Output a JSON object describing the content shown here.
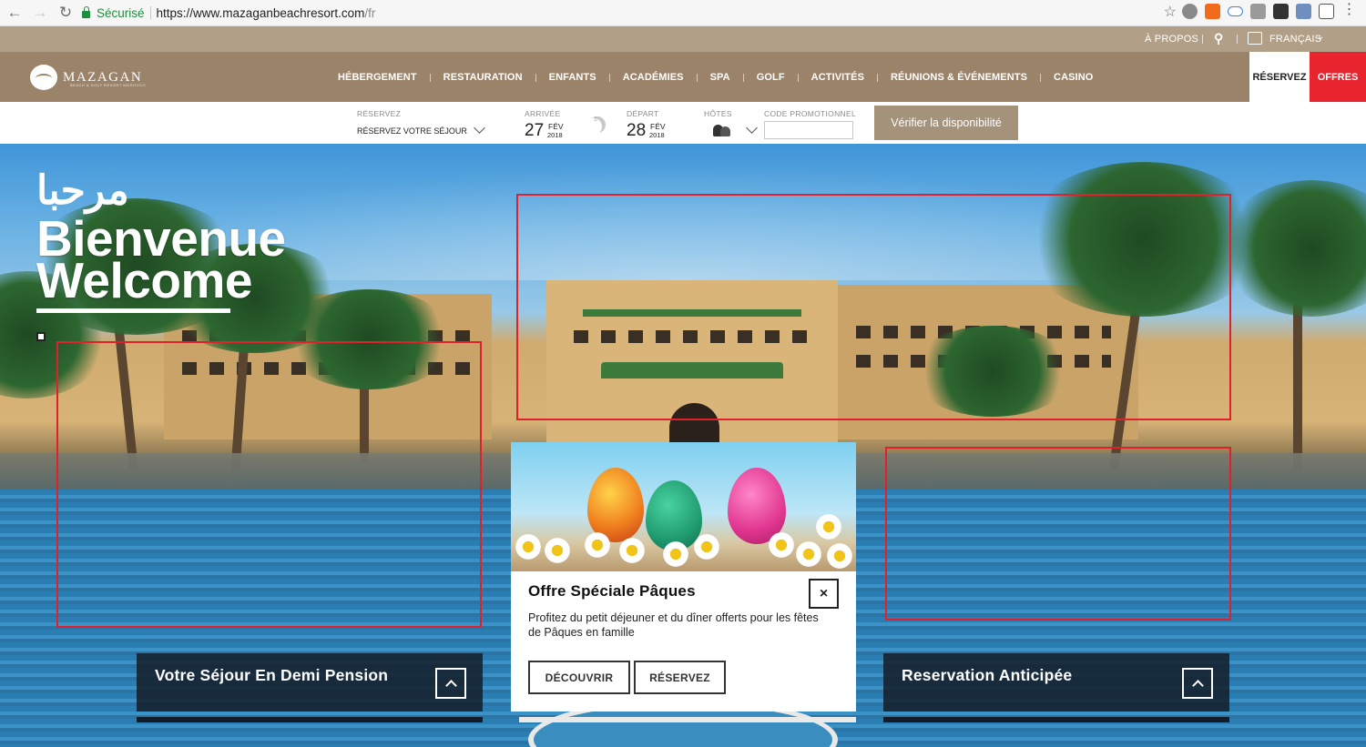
{
  "browser": {
    "secure_label": "Sécurisé",
    "url_host": "https://www.mazaganbeachresort.com",
    "url_path": "/fr"
  },
  "topbar": {
    "about": "À PROPOS",
    "language": "FRANÇAIS"
  },
  "nav": {
    "brand": "MAZAGAN",
    "brand_tagline": "BEACH & GOLF RESORT  MOROCCO",
    "items": [
      "HÉBERGEMENT",
      "RESTAURATION",
      "ENFANTS",
      "ACADÉMIES",
      "SPA",
      "GOLF",
      "ACTIVITÉS",
      "RÉUNIONS & ÉVÉNEMENTS",
      "CASINO"
    ],
    "reserve": "RÉSERVEZ",
    "offers": "OFFRES"
  },
  "booking": {
    "reserve_label": "RÉSERVEZ",
    "reserve_value": "RÉSERVEZ VOTRE SÉJOUR",
    "arrival_label": "ARRIVÉE",
    "arrival_day": "27",
    "arrival_month": "FÉV",
    "arrival_year": "2018",
    "nights": "1",
    "departure_label": "DÉPART",
    "departure_day": "28",
    "departure_month": "FÉV",
    "departure_year": "2018",
    "guests_label": "HÔTES",
    "promo_label": "CODE PROMOTIONNEL",
    "promo_value": "",
    "verify_button": "Vérifier la disponibilité"
  },
  "hero": {
    "arabic": "مرحبا",
    "welcome_fr": "Bienvenue",
    "welcome_en": "Welcome"
  },
  "cards": {
    "left_title": "Votre Séjour En Demi Pension",
    "right_title": "Reservation Anticipée"
  },
  "popup": {
    "title": "Offre Spéciale Pâques",
    "description": "Profitez du petit déjeuner et du dîner offerts pour les fêtes de Pâques en famille",
    "close": "×",
    "discover_button": "DÉCOUVRIR",
    "reserve_button": "RÉSERVEZ"
  },
  "colors": {
    "nav_brown": "#9b836a",
    "topbar_tan": "#b29f87",
    "offers_red": "#e8252e",
    "verify_button": "#a4927a",
    "frame_red": "#e0202a"
  }
}
